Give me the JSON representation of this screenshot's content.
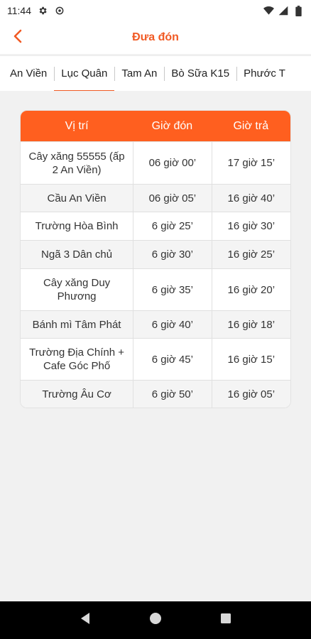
{
  "status_bar": {
    "time": "11:44",
    "icons": [
      "gear-icon",
      "sync-icon",
      "wifi-icon",
      "signal-icon",
      "battery-icon"
    ]
  },
  "app_bar": {
    "title": "Đưa đón",
    "back_icon": "chevron-left-icon"
  },
  "colors": {
    "accent": "#f15a24",
    "header_bg": "#ff5f1f"
  },
  "tabs": [
    {
      "label": "An Viền",
      "active": false
    },
    {
      "label": "Lục Quân",
      "active": true
    },
    {
      "label": "Tam An",
      "active": false
    },
    {
      "label": "Bò Sữa K15",
      "active": false
    },
    {
      "label": "Phước T",
      "active": false
    }
  ],
  "schedule": {
    "headers": [
      "Vị trí",
      "Giờ đón",
      "Giờ trả"
    ],
    "rows": [
      [
        "Cây xăng 55555 (ấp 2 An Viền)",
        "06 giờ 00’",
        "17 giờ 15’"
      ],
      [
        "Cầu An Viền",
        "06 giờ 05’",
        "16 giờ 40’"
      ],
      [
        "Trường Hòa Bình",
        "6 giờ 25’",
        "16 giờ 30’"
      ],
      [
        "Ngã 3 Dân chủ",
        "6 giờ 30’",
        "16 giờ 25’"
      ],
      [
        "Cây xăng Duy Phương",
        "6 giờ 35’",
        "16 giờ 20’"
      ],
      [
        "Bánh mì Tâm Phát",
        "6 giờ 40’",
        "16 giờ 18’"
      ],
      [
        "Trường Địa Chính + Cafe Góc Phố",
        "6 giờ 45’",
        "16 giờ 15’"
      ],
      [
        "Trường Âu Cơ",
        "6 giờ 50’",
        "16 giờ 05’"
      ]
    ]
  },
  "nav_bar": {
    "icons": [
      "back-triangle-icon",
      "home-circle-icon",
      "recents-square-icon"
    ]
  }
}
